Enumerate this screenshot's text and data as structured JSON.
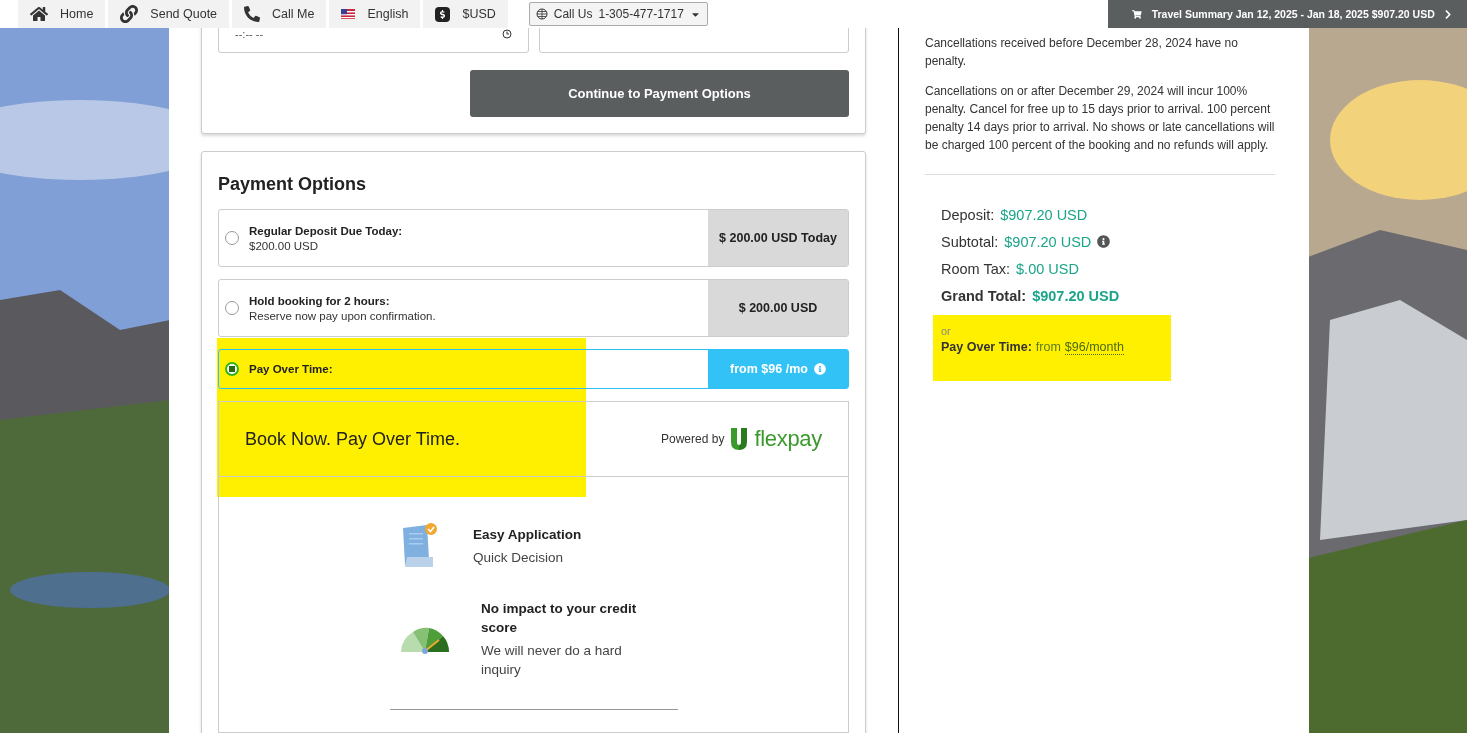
{
  "nav": {
    "items": [
      {
        "kind": "home",
        "label": "Home"
      },
      {
        "kind": "link",
        "label": "Send Quote"
      },
      {
        "kind": "phone",
        "label": "Call Me"
      },
      {
        "kind": "flag",
        "label": "English"
      },
      {
        "kind": "currency",
        "label": "$USD"
      }
    ],
    "call_us": {
      "label": "Call Us",
      "phone": "1-305-477-1717"
    }
  },
  "travel_summary": {
    "label": "Travel Summary Jan 12, 2025 - Jan 18, 2025 $907.20 USD"
  },
  "booking_form": {
    "time_field": {
      "placeholder": "--:-- --"
    },
    "continue_button": "Continue to Payment Options"
  },
  "payment_options": {
    "title": "Payment Options",
    "options": [
      {
        "title": "Regular Deposit Due Today:",
        "detail": "$200.00 USD",
        "price": "$ 200.00 USD Today",
        "selected": false,
        "info": false
      },
      {
        "title": "Hold booking for 2 hours:",
        "detail": "Reserve now pay upon confirmation.",
        "price": "$ 200.00 USD",
        "selected": false,
        "info": false
      },
      {
        "title": "Pay Over Time:",
        "price": "from $96 /mo",
        "selected": true,
        "info": true
      }
    ]
  },
  "flexpay": {
    "highlighted": true,
    "headline": "Book Now. Pay Over Time.",
    "powered_by": "Powered by",
    "brand": "flexpay",
    "features": [
      {
        "kind": "document",
        "title": "Easy Application",
        "detail": "Quick Decision"
      },
      {
        "kind": "gauge",
        "title": "No impact to your credit score",
        "detail": "We will never do a hard inquiry"
      }
    ]
  },
  "policy": [
    "Cancellations received before December 28, 2024 have no penalty.",
    "Cancellations on or after December 29, 2024 will incur 100% penalty. Cancel for free up to 15 days prior to arrival. 100 percent penalty 14 days prior to arrival. No shows or late cancellations will be charged 100 percent of the booking and no refunds will apply."
  ],
  "totals": [
    {
      "label": "Deposit:",
      "value": "$907.20 USD",
      "bold": false,
      "info": false
    },
    {
      "label": "Subtotal:",
      "value": "$907.20 USD",
      "bold": false,
      "info": true
    },
    {
      "label": "Room Tax:",
      "value": "$.00 USD",
      "bold": false,
      "info": false
    },
    {
      "label": "Grand Total:",
      "value": "$907.20 USD",
      "bold": true,
      "info": false
    }
  ],
  "pay_over_time": {
    "highlighted": true,
    "or": "or",
    "label": "Pay Over Time:",
    "from": "from",
    "amount": "$96",
    "unit": "/month"
  }
}
